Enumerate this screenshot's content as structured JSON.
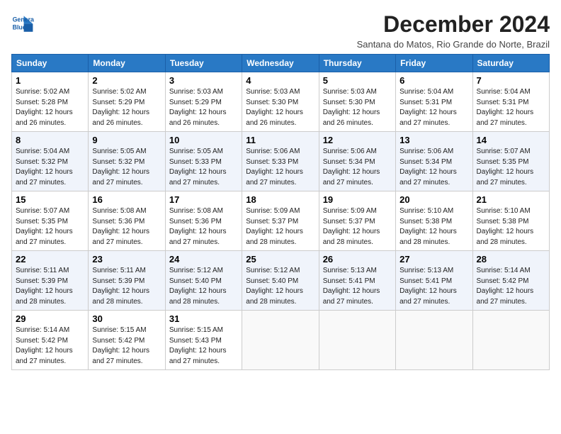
{
  "logo": {
    "line1": "General",
    "line2": "Blue"
  },
  "title": "December 2024",
  "subtitle": "Santana do Matos, Rio Grande do Norte, Brazil",
  "days_header": [
    "Sunday",
    "Monday",
    "Tuesday",
    "Wednesday",
    "Thursday",
    "Friday",
    "Saturday"
  ],
  "weeks": [
    [
      {
        "day": "1",
        "info": "Sunrise: 5:02 AM\nSunset: 5:28 PM\nDaylight: 12 hours\nand 26 minutes."
      },
      {
        "day": "2",
        "info": "Sunrise: 5:02 AM\nSunset: 5:29 PM\nDaylight: 12 hours\nand 26 minutes."
      },
      {
        "day": "3",
        "info": "Sunrise: 5:03 AM\nSunset: 5:29 PM\nDaylight: 12 hours\nand 26 minutes."
      },
      {
        "day": "4",
        "info": "Sunrise: 5:03 AM\nSunset: 5:30 PM\nDaylight: 12 hours\nand 26 minutes."
      },
      {
        "day": "5",
        "info": "Sunrise: 5:03 AM\nSunset: 5:30 PM\nDaylight: 12 hours\nand 26 minutes."
      },
      {
        "day": "6",
        "info": "Sunrise: 5:04 AM\nSunset: 5:31 PM\nDaylight: 12 hours\nand 27 minutes."
      },
      {
        "day": "7",
        "info": "Sunrise: 5:04 AM\nSunset: 5:31 PM\nDaylight: 12 hours\nand 27 minutes."
      }
    ],
    [
      {
        "day": "8",
        "info": "Sunrise: 5:04 AM\nSunset: 5:32 PM\nDaylight: 12 hours\nand 27 minutes."
      },
      {
        "day": "9",
        "info": "Sunrise: 5:05 AM\nSunset: 5:32 PM\nDaylight: 12 hours\nand 27 minutes."
      },
      {
        "day": "10",
        "info": "Sunrise: 5:05 AM\nSunset: 5:33 PM\nDaylight: 12 hours\nand 27 minutes."
      },
      {
        "day": "11",
        "info": "Sunrise: 5:06 AM\nSunset: 5:33 PM\nDaylight: 12 hours\nand 27 minutes."
      },
      {
        "day": "12",
        "info": "Sunrise: 5:06 AM\nSunset: 5:34 PM\nDaylight: 12 hours\nand 27 minutes."
      },
      {
        "day": "13",
        "info": "Sunrise: 5:06 AM\nSunset: 5:34 PM\nDaylight: 12 hours\nand 27 minutes."
      },
      {
        "day": "14",
        "info": "Sunrise: 5:07 AM\nSunset: 5:35 PM\nDaylight: 12 hours\nand 27 minutes."
      }
    ],
    [
      {
        "day": "15",
        "info": "Sunrise: 5:07 AM\nSunset: 5:35 PM\nDaylight: 12 hours\nand 27 minutes."
      },
      {
        "day": "16",
        "info": "Sunrise: 5:08 AM\nSunset: 5:36 PM\nDaylight: 12 hours\nand 27 minutes."
      },
      {
        "day": "17",
        "info": "Sunrise: 5:08 AM\nSunset: 5:36 PM\nDaylight: 12 hours\nand 27 minutes."
      },
      {
        "day": "18",
        "info": "Sunrise: 5:09 AM\nSunset: 5:37 PM\nDaylight: 12 hours\nand 28 minutes."
      },
      {
        "day": "19",
        "info": "Sunrise: 5:09 AM\nSunset: 5:37 PM\nDaylight: 12 hours\nand 28 minutes."
      },
      {
        "day": "20",
        "info": "Sunrise: 5:10 AM\nSunset: 5:38 PM\nDaylight: 12 hours\nand 28 minutes."
      },
      {
        "day": "21",
        "info": "Sunrise: 5:10 AM\nSunset: 5:38 PM\nDaylight: 12 hours\nand 28 minutes."
      }
    ],
    [
      {
        "day": "22",
        "info": "Sunrise: 5:11 AM\nSunset: 5:39 PM\nDaylight: 12 hours\nand 28 minutes."
      },
      {
        "day": "23",
        "info": "Sunrise: 5:11 AM\nSunset: 5:39 PM\nDaylight: 12 hours\nand 28 minutes."
      },
      {
        "day": "24",
        "info": "Sunrise: 5:12 AM\nSunset: 5:40 PM\nDaylight: 12 hours\nand 28 minutes."
      },
      {
        "day": "25",
        "info": "Sunrise: 5:12 AM\nSunset: 5:40 PM\nDaylight: 12 hours\nand 28 minutes."
      },
      {
        "day": "26",
        "info": "Sunrise: 5:13 AM\nSunset: 5:41 PM\nDaylight: 12 hours\nand 27 minutes."
      },
      {
        "day": "27",
        "info": "Sunrise: 5:13 AM\nSunset: 5:41 PM\nDaylight: 12 hours\nand 27 minutes."
      },
      {
        "day": "28",
        "info": "Sunrise: 5:14 AM\nSunset: 5:42 PM\nDaylight: 12 hours\nand 27 minutes."
      }
    ],
    [
      {
        "day": "29",
        "info": "Sunrise: 5:14 AM\nSunset: 5:42 PM\nDaylight: 12 hours\nand 27 minutes."
      },
      {
        "day": "30",
        "info": "Sunrise: 5:15 AM\nSunset: 5:42 PM\nDaylight: 12 hours\nand 27 minutes."
      },
      {
        "day": "31",
        "info": "Sunrise: 5:15 AM\nSunset: 5:43 PM\nDaylight: 12 hours\nand 27 minutes."
      },
      null,
      null,
      null,
      null
    ]
  ]
}
